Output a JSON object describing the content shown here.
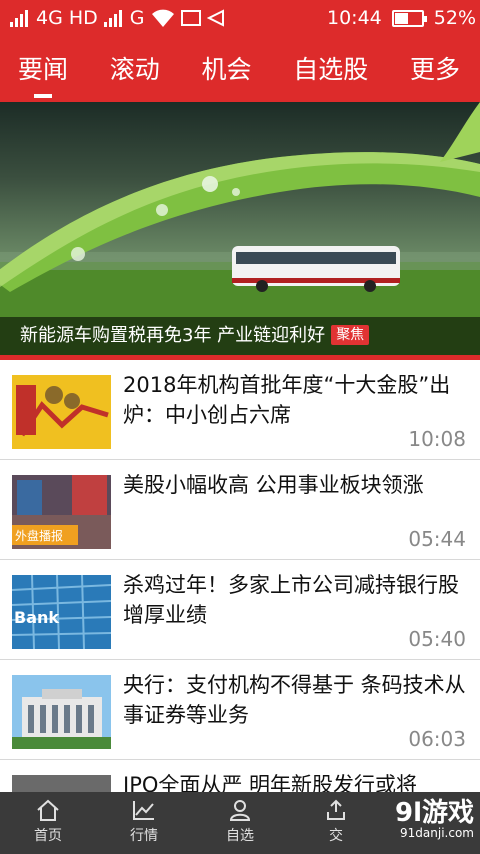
{
  "status_bar": {
    "network": "4G HD",
    "network2": "G",
    "time": "10:44",
    "battery": "52%",
    "battery_level": 0.52
  },
  "tabs": [
    {
      "label": "要闻",
      "active": true
    },
    {
      "label": "滚动",
      "active": false
    },
    {
      "label": "机会",
      "active": false
    },
    {
      "label": "自选股",
      "active": false
    },
    {
      "label": "更多",
      "active": false
    }
  ],
  "banner": {
    "caption": "新能源车购置税再免3年 产业链迎利好",
    "badge": "聚焦"
  },
  "news": [
    {
      "title": "2018年机构首批年度“十大金股”出炉：中小创占六席",
      "time": "10:08",
      "thumb_icon": "stock-chart-thumbnail"
    },
    {
      "title": "美股小幅收高 公用事业板块领涨",
      "time": "05:44",
      "thumb_icon": "street-scene-thumbnail",
      "thumb_label": "外盘播报"
    },
    {
      "title": "杀鸡过年！多家上市公司减持银行股增厚业绩",
      "time": "05:40",
      "thumb_icon": "bank-building-thumbnail",
      "thumb_label": "Bank"
    },
    {
      "title": "央行：支付机构不得基于 条码技术从事证券等业务",
      "time": "06:03",
      "thumb_icon": "central-bank-thumbnail"
    },
    {
      "title": "IPO全面从严 明年新股发行或将",
      "time": "",
      "thumb_icon": "ipo-thumbnail"
    }
  ],
  "bottom_nav": [
    {
      "label": "首页",
      "icon": "home-icon"
    },
    {
      "label": "行情",
      "icon": "chart-icon"
    },
    {
      "label": "自选",
      "icon": "user-icon"
    },
    {
      "label": "交",
      "icon": "trade-icon"
    },
    {
      "label": "",
      "icon": ""
    }
  ],
  "watermark": {
    "text": "9l游戏",
    "url": "91danji.com",
    "overlay_text": "91游戏",
    "overlay_url": "91danji.com"
  }
}
